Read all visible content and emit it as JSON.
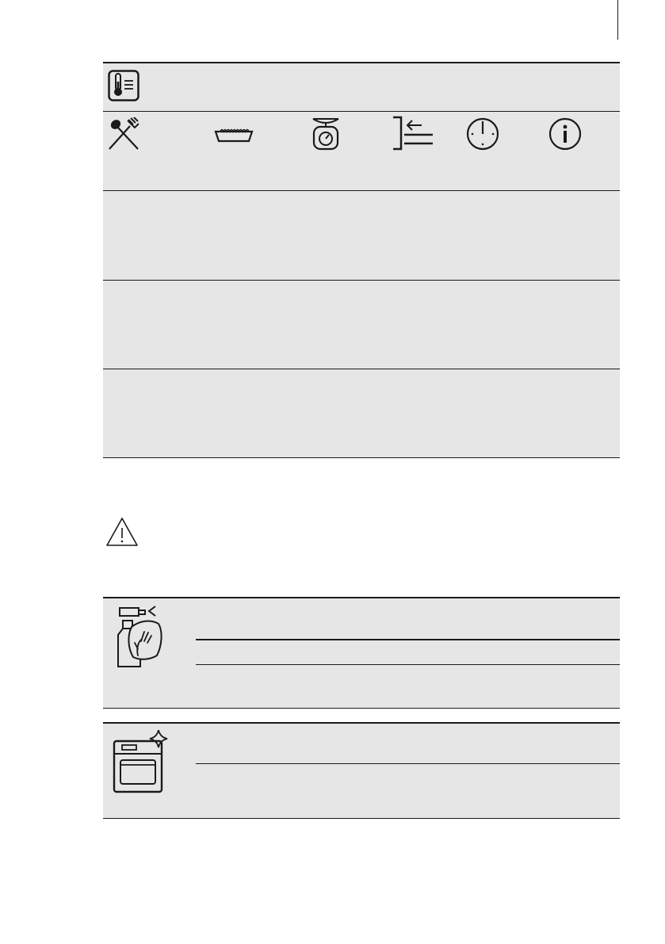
{
  "page": {
    "background": "#ffffff",
    "table_background": "#e6e6e6",
    "line_color": "#1a1a1a"
  },
  "food_table": {
    "header_icon": "food-sensor-thermometer-icon",
    "column_icons": [
      "cutlery-icon",
      "baking-dish-icon",
      "kitchen-scale-icon",
      "shelf-position-icon",
      "clock-icon",
      "info-icon"
    ],
    "rows": [
      {
        "cells": []
      },
      {
        "cells": []
      },
      {
        "cells": []
      }
    ]
  },
  "warning": {
    "icon": "warning-triangle-icon"
  },
  "cleaning_table": {
    "icon": "spray-and-cloth-icon"
  },
  "oven_table": {
    "icon": "clean-oven-sparkle-icon"
  }
}
